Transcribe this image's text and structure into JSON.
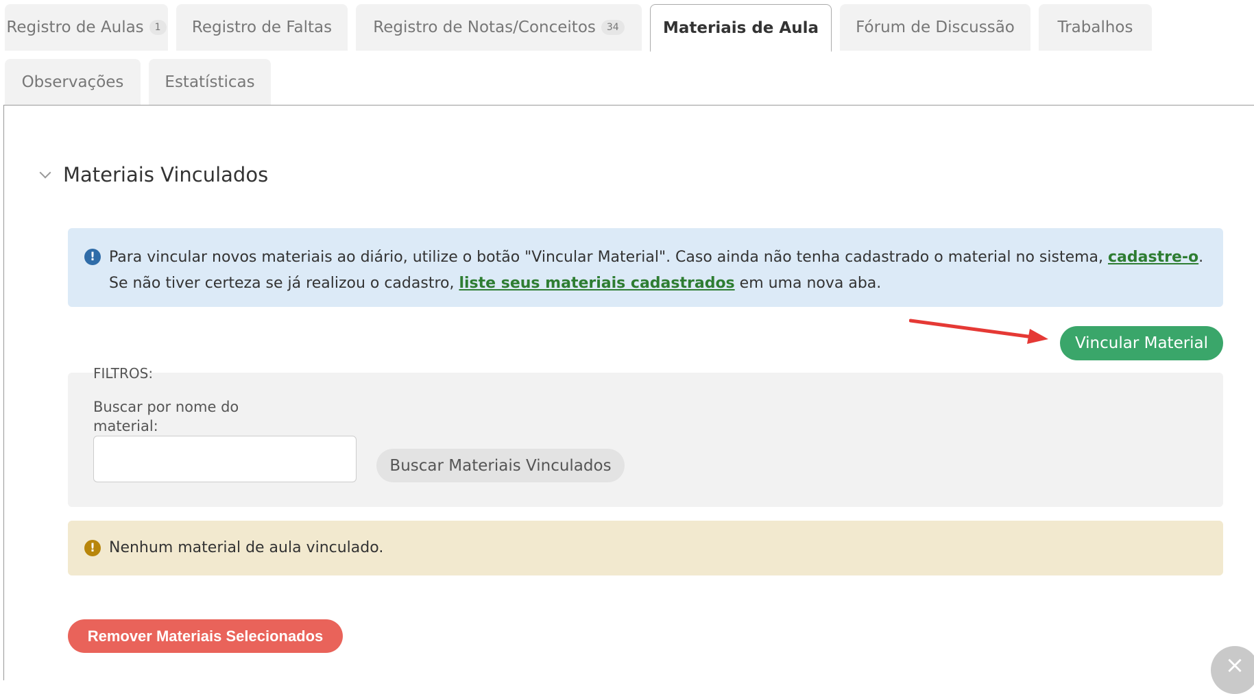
{
  "tabs": {
    "row1": [
      {
        "label": "Registro de Aulas",
        "badge": "1"
      },
      {
        "label": "Registro de Faltas"
      },
      {
        "label": "Registro de Notas/Conceitos",
        "badge": "34"
      },
      {
        "label": "Materiais de Aula",
        "active": true
      },
      {
        "label": "Fórum de Discussão"
      },
      {
        "label": "Trabalhos"
      }
    ],
    "row2": [
      {
        "label": "Observações"
      },
      {
        "label": "Estatísticas"
      }
    ]
  },
  "section": {
    "title": "Materiais Vinculados",
    "chevron_icon": "chevron-down-icon"
  },
  "info": {
    "icon": "info-icon",
    "text_1": "Para vincular novos materiais ao diário, utilize o botão \"Vincular Material\". Caso ainda não tenha cadastrado o material no sistema,",
    "link_1": "cadastre-o",
    "text_2": ".",
    "text_3": "Se não tiver certeza se já realizou o cadastro,",
    "link_2": "liste seus materiais cadastrados",
    "text_4": "em uma nova aba."
  },
  "actions": {
    "vincular_label": "Vincular Material",
    "remover_label": "Remover Materiais Selecionados"
  },
  "filters": {
    "legend": "FILTROS:",
    "search_label": "Buscar por nome do material:",
    "search_value": "",
    "search_button": "Buscar Materiais Vinculados"
  },
  "warning": {
    "icon": "warning-icon",
    "text": "Nenhum material de aula vinculado."
  },
  "colors": {
    "green_button": "#3aa66a",
    "red_button": "#e9635a",
    "info_bg": "#dceaf7",
    "warning_bg": "#f2e9cf",
    "annotation_arrow": "#e53935"
  }
}
